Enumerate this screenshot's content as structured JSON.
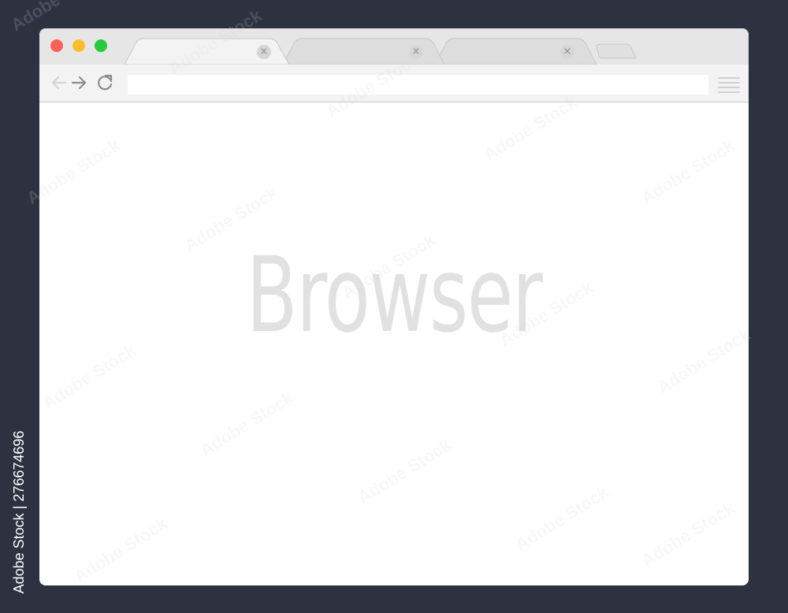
{
  "window": {
    "traffic_lights": [
      {
        "name": "close",
        "color": "#ff6157"
      },
      {
        "name": "minimize",
        "color": "#ffbd2e"
      },
      {
        "name": "zoom",
        "color": "#27c93f"
      }
    ],
    "tabs": [
      {
        "label": "",
        "active": true,
        "close_glyph": "×"
      },
      {
        "label": "",
        "active": false,
        "close_glyph": "×"
      },
      {
        "label": "",
        "active": false,
        "close_glyph": "×"
      }
    ]
  },
  "toolbar": {
    "back_icon": "arrow-left-icon",
    "forward_icon": "arrow-right-icon",
    "reload_icon": "reload-icon",
    "address_value": "",
    "address_placeholder": "",
    "menu_icon": "hamburger-menu-icon"
  },
  "page": {
    "heading": "Browser"
  },
  "watermark": {
    "text": "Adobe Stock",
    "side_credit": "Adobe Stock | 276674696"
  },
  "colors": {
    "background": "#2d3140",
    "titlebar": "#e6e6e6",
    "active_tab": "#f3f3f3",
    "inactive_tab": "#dddddd",
    "toolbar": "#f3f3f3",
    "heading_text": "#e1e1e1"
  }
}
